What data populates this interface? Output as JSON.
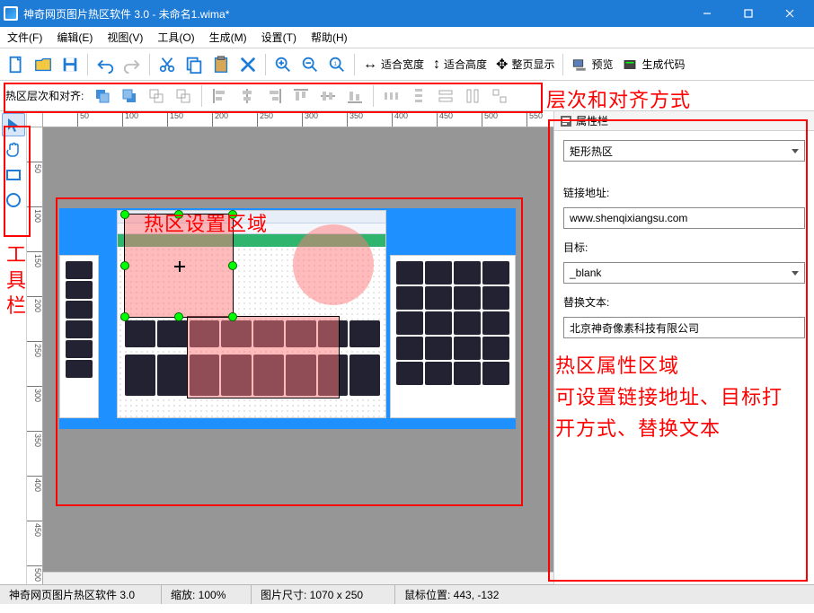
{
  "titlebar": {
    "title": "神奇网页图片热区软件 3.0 - 未命名1.wima*"
  },
  "menus": [
    "文件(F)",
    "编辑(E)",
    "视图(V)",
    "工具(O)",
    "生成(M)",
    "设置(T)",
    "帮助(H)"
  ],
  "toolbar": {
    "fit_width": "适合宽度",
    "fit_height": "适合高度",
    "full_page": "整页显示",
    "preview": "预览",
    "gen_code": "生成代码"
  },
  "alignbar": {
    "label": "热区层次和对齐:"
  },
  "ruler_h": [
    "50",
    "100",
    "150",
    "200",
    "250",
    "300",
    "350",
    "400",
    "450",
    "500",
    "550"
  ],
  "ruler_v": [
    "50",
    "100",
    "150",
    "200",
    "250",
    "300",
    "350",
    "400",
    "450",
    "500"
  ],
  "props": {
    "title": "属性栏",
    "type": "矩形热区",
    "link_label": "链接地址:",
    "link_value": "www.shenqixiangsu.com",
    "target_label": "目标:",
    "target_value": "_blank",
    "alt_label": "替换文本:",
    "alt_value": "北京神奇像素科技有限公司"
  },
  "status": {
    "app": "神奇网页图片热区软件 3.0",
    "zoom": "缩放:  100%",
    "size": "图片尺寸:  1070 x 250",
    "mouse": "鼠标位置:  443, -132"
  },
  "annot": {
    "align": "层次和对齐方式",
    "tools": "工具栏",
    "canvas": "热区设置区域",
    "props1": "热区属性区域",
    "props2": "可设置链接地址、目标打开方式、替换文本"
  }
}
